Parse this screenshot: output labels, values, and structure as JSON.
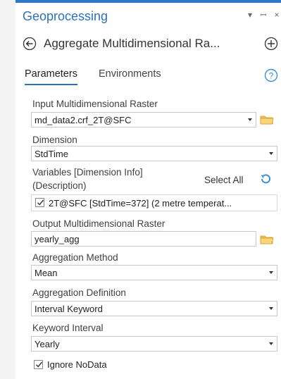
{
  "pane": {
    "title": "Geoprocessing",
    "controls": [
      "▾",
      "⁠⫯",
      "×"
    ]
  },
  "tool": {
    "title": "Aggregate Multidimensional Ra..."
  },
  "tabs": {
    "parameters": "Parameters",
    "environments": "Environments"
  },
  "params": {
    "input_raster": {
      "label": "Input Multidimensional Raster",
      "value": "md_data2.crf_2T@SFC"
    },
    "dimension": {
      "label": "Dimension",
      "value": "StdTime"
    },
    "variables": {
      "label_line1": "Variables [Dimension Info]",
      "label_line2": "(Description)",
      "select_all": "Select All",
      "item": "2T@SFC [StdTime=372] (2 metre temperat..."
    },
    "output_raster": {
      "label": "Output Multidimensional Raster",
      "value": "yearly_agg"
    },
    "aggregation_method": {
      "label": "Aggregation Method",
      "value": "Mean"
    },
    "aggregation_definition": {
      "label": "Aggregation Definition",
      "value": "Interval Keyword"
    },
    "keyword_interval": {
      "label": "Keyword Interval",
      "value": "Yearly"
    },
    "ignore_nodata": {
      "label": "Ignore NoData",
      "checked": true
    }
  },
  "colors": {
    "accent": "#2f72b8",
    "folder": "#f2c14e",
    "help": "#3a8fd6"
  }
}
